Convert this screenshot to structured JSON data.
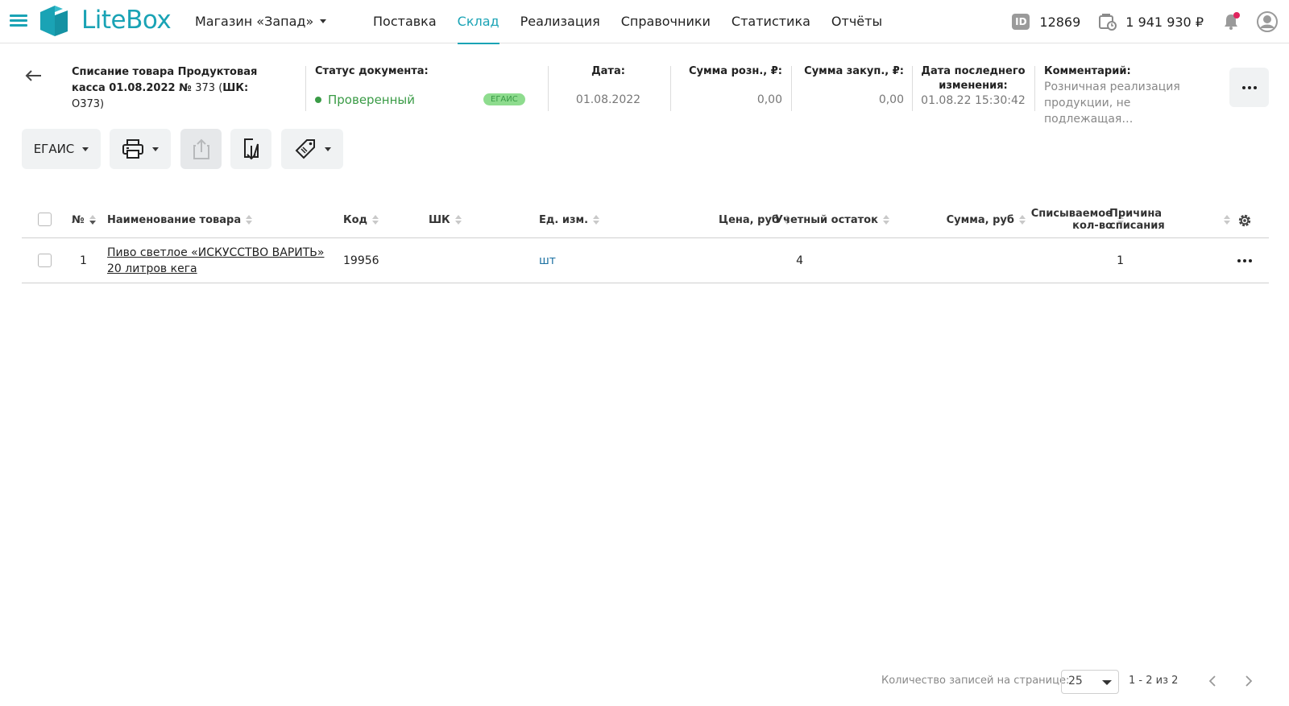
{
  "header": {
    "logo": "LiteBox",
    "store": "Магазин «Запад»",
    "nav": [
      "Поставка",
      "Склад",
      "Реализация",
      "Справочники",
      "Статистика",
      "Отчёты"
    ],
    "active_nav": "Склад",
    "id_badge": "ID",
    "id_value": "12869",
    "balance": "1 941 930 ₽"
  },
  "document": {
    "title": "Списание товара Продуктовая касса 01.08.2022 №",
    "number": "373 (",
    "barcode_label": "ШК:",
    "barcode": "О373)",
    "status_label": "Статус документа:",
    "status": "Проверенный",
    "egais_tag": "ЕГАИС",
    "date_label": "Дата:",
    "date": "01.08.2022",
    "retail_sum_label": "Сумма розн., ₽:",
    "retail_sum": "0,00",
    "purchase_sum_label": "Сумма закуп., ₽:",
    "purchase_sum": "0,00",
    "modified_label_1": "Дата последнего",
    "modified_label_2": "изменения:",
    "modified": "01.08.22 15:30:42",
    "comment_label": "Комментарий:",
    "comment_line1": "Розничная реализация",
    "comment_line2": "продукции, не подлежащая…"
  },
  "toolbar": {
    "egais_button": "ЕГАИС"
  },
  "table": {
    "headers": {
      "num": "№",
      "name": "Наименование товара",
      "code": "Код",
      "barcode": "ШК",
      "unit": "Ед. изм.",
      "price": "Цена, руб",
      "stock": "Учетный остаток",
      "sum": "Сумма, руб",
      "qty_1": "Списываемое",
      "qty_2": "кол-во",
      "reason_1": "Причина",
      "reason_2": "списания"
    },
    "rows": [
      {
        "num": "1",
        "name_1": "Пиво светлое «ИСКУССТВО ВАРИТЬ»",
        "name_2": "20 литров кега",
        "code": "19956",
        "barcode": "",
        "unit": "шт",
        "price": "",
        "stock": "4",
        "sum": "",
        "qty": "1",
        "reason": ""
      }
    ]
  },
  "pager": {
    "label": "Количество записей на странице:",
    "per_page": "25",
    "range": "1 - 2 из 2"
  },
  "colors": {
    "accent": "#1aa3b5",
    "status_green": "#3a9b46",
    "notification": "#e0245e"
  }
}
